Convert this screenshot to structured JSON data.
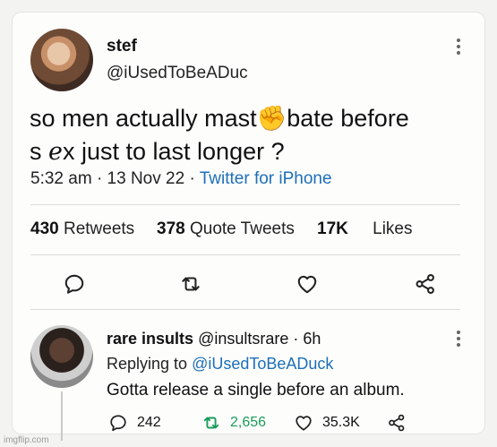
{
  "tweet": {
    "display_name": "stef",
    "handle": "@iUsedToBeADuc",
    "text_line1": "so men actually mast✊bate before",
    "text_line2": "s ℯx just to last longer ?",
    "time": "5:32 am",
    "date": "13 Nov 22",
    "source": "Twitter for iPhone",
    "retweets_count": "430",
    "retweets_label": "Retweets",
    "quotes_count": "378",
    "quotes_label": "Quote Tweets",
    "likes_count": "17K",
    "likes_label": "Likes",
    "icons": [
      "reply-icon",
      "retweet-icon",
      "like-icon",
      "share-icon",
      "more-icon"
    ]
  },
  "reply": {
    "display_name": "rare insults",
    "handle": "@insultsrare",
    "age": "6h",
    "replying_label": "Replying to",
    "replying_to": "@iUsedToBeADuck",
    "text": "Gotta release a single before an album.",
    "reply_count": "242",
    "retweet_count": "2,656",
    "like_count": "35.3K",
    "retweet_color": "#1a9c5b"
  },
  "watermark": "imgflip.com"
}
